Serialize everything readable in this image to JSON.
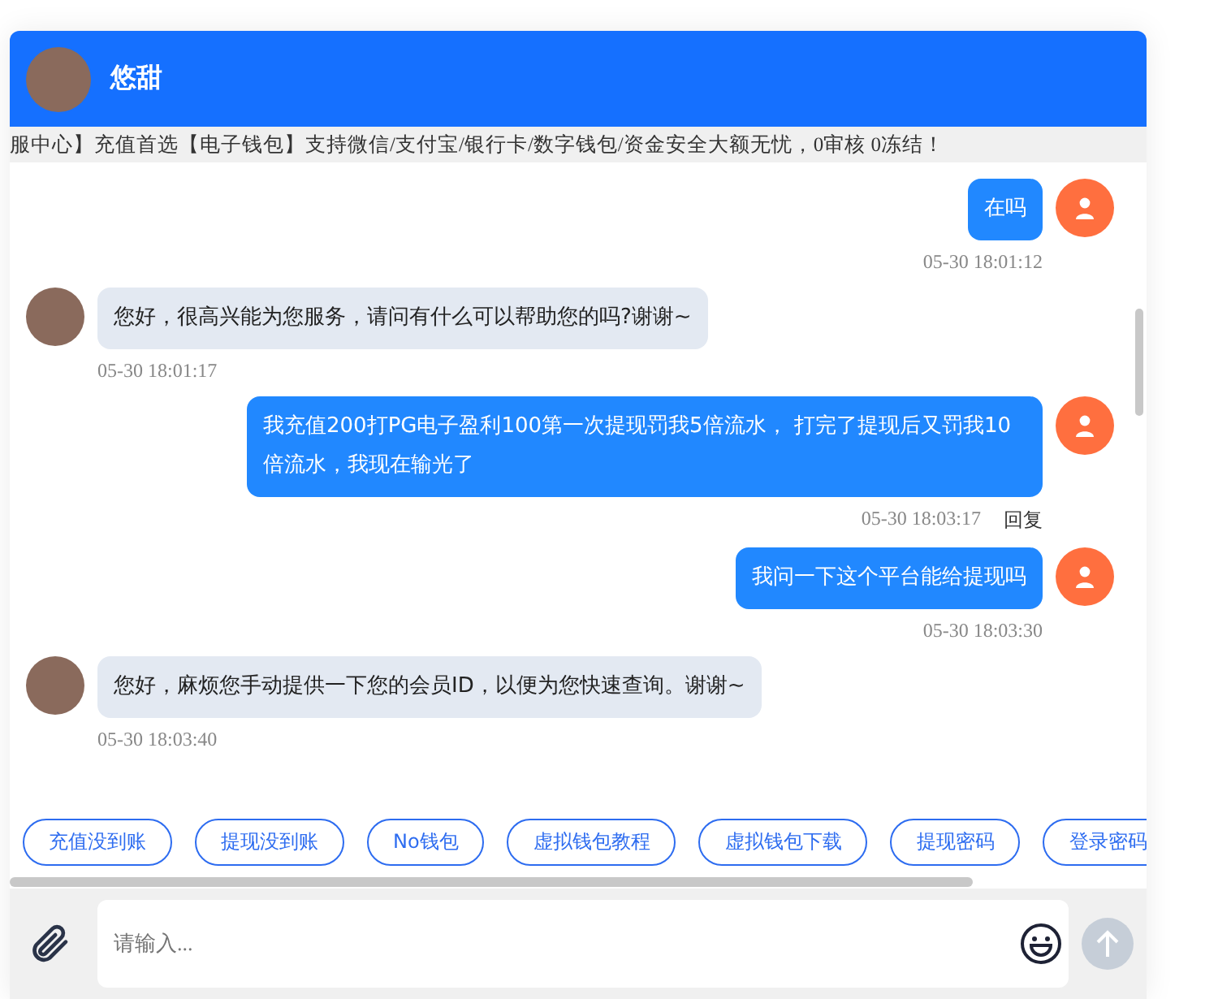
{
  "header": {
    "name": "悠甜"
  },
  "notice": "服中心】充值首选【电子钱包】支持微信/支付宝/银行卡/数字钱包/资金安全大额无忧，0审核 0冻结！",
  "messages": [
    {
      "kind": "sent",
      "text": "在吗",
      "time": "05-30 18:01:12"
    },
    {
      "kind": "received",
      "text": "您好，很高兴能为您服务，请问有什么可以帮助您的吗?谢谢~",
      "time": "05-30 18:01:17"
    },
    {
      "kind": "sent",
      "text": "我充值200打PG电子盈利100第一次提现罚我5倍流水， 打完了提现后又罚我10倍流水，我现在输光了",
      "time": "05-30 18:03:17",
      "reply": "回复"
    },
    {
      "kind": "sent",
      "text": "我问一下这个平台能给提现吗",
      "time": "05-30 18:03:30"
    },
    {
      "kind": "received",
      "text": "您好，麻烦您手动提供一下您的会员ID，以便为您快速查询。谢谢~",
      "time": "05-30 18:03:40"
    }
  ],
  "quick_replies": [
    "充值没到账",
    "提现没到账",
    "No钱包",
    "虚拟钱包教程",
    "虚拟钱包下载",
    "提现密码",
    "登录密码"
  ],
  "input": {
    "placeholder": "请输入..."
  }
}
